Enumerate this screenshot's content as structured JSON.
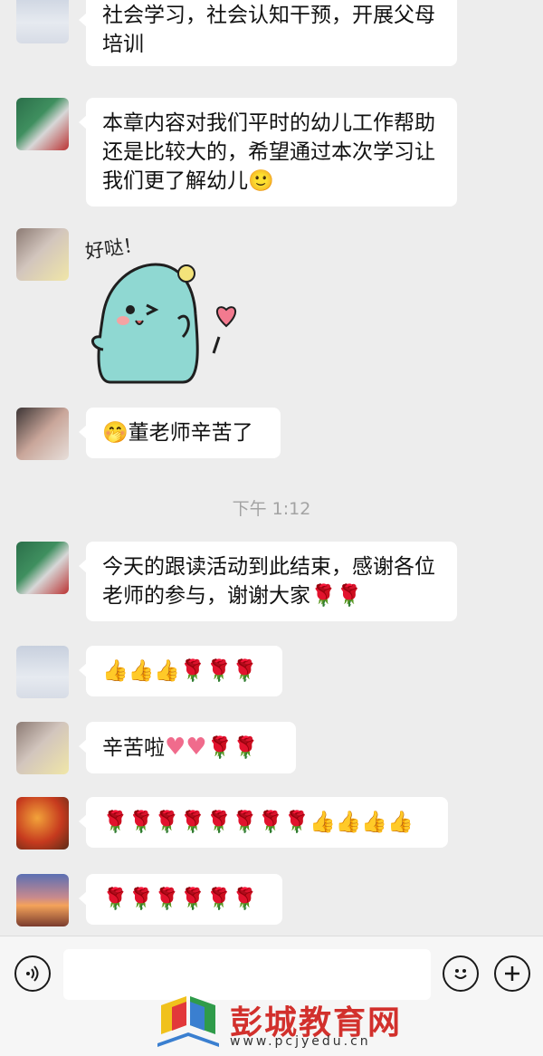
{
  "messages": [
    {
      "id": "m1",
      "avatar": "sky",
      "text": "社会学习，社会认知干预，开展父母培训"
    },
    {
      "id": "m2",
      "avatar": "joker",
      "text": "本章内容对我们平时的幼儿工作帮助还是比较大的，希望通过本次学习让我们更了解幼儿",
      "trailing_emoji": "🙂"
    },
    {
      "id": "m3",
      "avatar": "girl",
      "sticker_caption": "好哒！"
    },
    {
      "id": "m4",
      "avatar": "kid",
      "leading_emoji": "🤭",
      "text": "董老师辛苦了"
    },
    {
      "id": "m5",
      "avatar": "joker",
      "text": "今天的跟读活动到此结束，感谢各位老师的参与，谢谢大家",
      "trailing_emoji": "🌹🌹"
    },
    {
      "id": "m6",
      "avatar": "sky",
      "emojis": "👍👍👍🌹🌹🌹"
    },
    {
      "id": "m7",
      "avatar": "girl",
      "text": "辛苦啦",
      "hearts": "♥♥",
      "trailing_emoji": "🌹🌹"
    },
    {
      "id": "m8",
      "avatar": "leaf",
      "emojis": "🌹🌹🌹🌹🌹🌹🌹🌹👍👍👍👍"
    },
    {
      "id": "m9",
      "avatar": "sunset",
      "emojis": "🌹🌹🌹🌹🌹🌹"
    }
  ],
  "timestamp": "下午 1:12",
  "input_bar": {
    "voice_icon": "voice-icon",
    "emoji_icon": "emoji-icon",
    "plus_icon": "plus-icon",
    "input_value": ""
  },
  "watermark": {
    "brand": "彭城教育网",
    "url": "www.pcjyedu.cn"
  }
}
